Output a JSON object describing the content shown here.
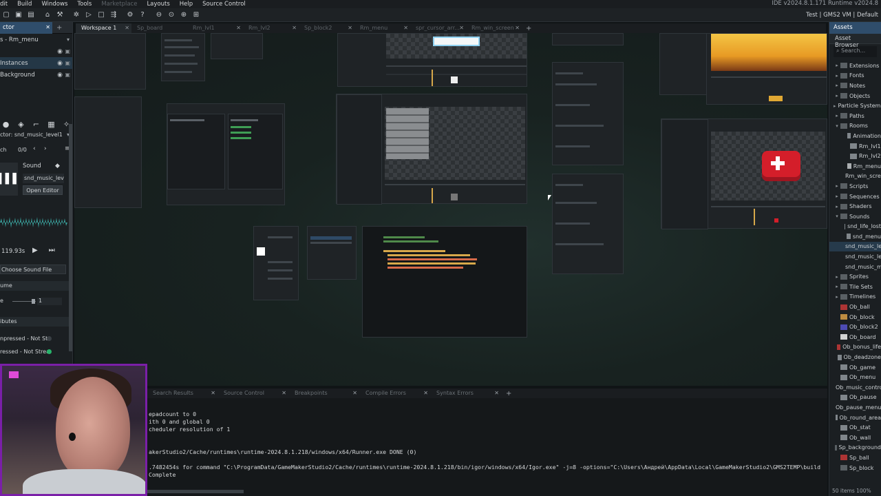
{
  "menubar": {
    "items": [
      "dit",
      "Build",
      "Windows",
      "Tools",
      "Marketplace",
      "Layouts",
      "Help",
      "Source Control"
    ],
    "ide_version": "IDE v2024.8.1.171  Runtime v2024.8"
  },
  "toolbar": {
    "target": "Test | GMS2 VM | Default"
  },
  "left": {
    "tab_label": "ctor",
    "room_name": "s - Rm_menu",
    "layers": [
      "Instances",
      "Background"
    ],
    "inspector_title": "ctor: snd_music_level1",
    "frame_counter": "0/0",
    "sound_type": "Sound",
    "sound_name": "snd_music_level1",
    "open_editor": "Open Editor",
    "duration": "119.93s",
    "choose_file": "Choose Sound File",
    "volume_header": "ume",
    "volume_label": "e",
    "volume_value": "1",
    "attributes_header": "ibutes",
    "compressed1": "npressed - Not Str",
    "compressed2": "ressed - Not Strea",
    "search_label": "ch"
  },
  "workspace_tabs": [
    {
      "label": "Workspace 1",
      "active": true
    },
    {
      "label": "Sp_board",
      "active": false
    },
    {
      "label": "Rm_lvl1",
      "active": false
    },
    {
      "label": "Rm_lvl2",
      "active": false
    },
    {
      "label": "Sp_block2",
      "active": false
    },
    {
      "label": "Rm_menu",
      "active": false
    },
    {
      "label": "spr_cursor_arr...",
      "active": false
    },
    {
      "label": "Rm_win_screen",
      "active": false
    }
  ],
  "assets": {
    "tab": "Assets",
    "title": "Asset Browser",
    "search_placeholder": "Search...",
    "items": [
      {
        "label": "Extensions",
        "indent": 1,
        "arrow": "▸",
        "color": "#6a7075"
      },
      {
        "label": "Fonts",
        "indent": 1,
        "arrow": "▸",
        "color": "#6a7075"
      },
      {
        "label": "Notes",
        "indent": 1,
        "arrow": "▸",
        "color": "#6a7075"
      },
      {
        "label": "Objects",
        "indent": 1,
        "arrow": "▸",
        "color": "#6a7075"
      },
      {
        "label": "Particle Systems",
        "indent": 1,
        "arrow": "▸",
        "color": "#6a7075"
      },
      {
        "label": "Paths",
        "indent": 1,
        "arrow": "▸",
        "color": "#6a7075"
      },
      {
        "label": "Rooms",
        "indent": 1,
        "arrow": "▾",
        "color": "#6a7075"
      },
      {
        "label": "Animation",
        "indent": 2,
        "arrow": "",
        "color": "#9aa0a6"
      },
      {
        "label": "Rm_lvl1",
        "indent": 2,
        "arrow": "",
        "color": "#9aa0a6"
      },
      {
        "label": "Rm_lvl2",
        "indent": 2,
        "arrow": "",
        "color": "#9aa0a6"
      },
      {
        "label": "Rm_menu",
        "indent": 2,
        "arrow": "",
        "color": "#cfd3d6"
      },
      {
        "label": "Rm_win_screen",
        "indent": 2,
        "arrow": "",
        "color": "#9aa0a6"
      },
      {
        "label": "Scripts",
        "indent": 1,
        "arrow": "▸",
        "color": "#6a7075"
      },
      {
        "label": "Sequences",
        "indent": 1,
        "arrow": "▸",
        "color": "#6a7075"
      },
      {
        "label": "Shaders",
        "indent": 1,
        "arrow": "▸",
        "color": "#6a7075"
      },
      {
        "label": "Sounds",
        "indent": 1,
        "arrow": "▾",
        "color": "#6a7075"
      },
      {
        "label": "snd_life_lost",
        "indent": 2,
        "arrow": "",
        "color": "#9aa0a6"
      },
      {
        "label": "snd_menu",
        "indent": 2,
        "arrow": "",
        "color": "#9aa0a6"
      },
      {
        "label": "snd_music_level1",
        "indent": 2,
        "arrow": "",
        "color": "#9aa0a6",
        "selected": true
      },
      {
        "label": "snd_music_level2",
        "indent": 2,
        "arrow": "",
        "color": "#9aa0a6"
      },
      {
        "label": "snd_music_menu",
        "indent": 2,
        "arrow": "",
        "color": "#9aa0a6"
      },
      {
        "label": "Sprites",
        "indent": 1,
        "arrow": "▸",
        "color": "#6a7075"
      },
      {
        "label": "Tile Sets",
        "indent": 1,
        "arrow": "▸",
        "color": "#6a7075"
      },
      {
        "label": "Timelines",
        "indent": 1,
        "arrow": "▸",
        "color": "#6a7075"
      },
      {
        "label": "Ob_ball",
        "indent": 1,
        "arrow": "",
        "color": "#d23a3a"
      },
      {
        "label": "Ob_block",
        "indent": 1,
        "arrow": "",
        "color": "#e7a84a"
      },
      {
        "label": "Ob_block2",
        "indent": 1,
        "arrow": "",
        "color": "#5a56d8"
      },
      {
        "label": "Ob_board",
        "indent": 1,
        "arrow": "",
        "color": "#ffffff"
      },
      {
        "label": "Ob_bonus_life",
        "indent": 1,
        "arrow": "",
        "color": "#d23a3a"
      },
      {
        "label": "Ob_deadzone",
        "indent": 1,
        "arrow": "",
        "color": "#9aa0a6"
      },
      {
        "label": "Ob_game",
        "indent": 1,
        "arrow": "",
        "color": "#9aa0a6"
      },
      {
        "label": "Ob_menu",
        "indent": 1,
        "arrow": "",
        "color": "#9aa0a6"
      },
      {
        "label": "Ob_music_controller",
        "indent": 1,
        "arrow": "",
        "color": "#9aa0a6"
      },
      {
        "label": "Ob_pause",
        "indent": 1,
        "arrow": "",
        "color": "#9aa0a6"
      },
      {
        "label": "Ob_pause_menu",
        "indent": 1,
        "arrow": "",
        "color": "#9aa0a6"
      },
      {
        "label": "Ob_round_area",
        "indent": 1,
        "arrow": "",
        "color": "#9aa0a6"
      },
      {
        "label": "Ob_stat",
        "indent": 1,
        "arrow": "",
        "color": "#9aa0a6"
      },
      {
        "label": "Ob_wall",
        "indent": 1,
        "arrow": "",
        "color": "#9aa0a6"
      },
      {
        "label": "Sp_background",
        "indent": 1,
        "arrow": "",
        "color": "#6a7075"
      },
      {
        "label": "Sp_ball",
        "indent": 1,
        "arrow": "",
        "color": "#d23a3a"
      },
      {
        "label": "Sp_block",
        "indent": 1,
        "arrow": "",
        "color": "#6a7075"
      }
    ],
    "footer": "50 items   100%"
  },
  "bottom": {
    "tabs": [
      "Search Results",
      "Source Control",
      "Breakpoints",
      "Compile Errors",
      "Syntax Errors"
    ],
    "lines": [
      "epadcount to 0",
      "ith 0 and global 0",
      "cheduler resolution of 1",
      "",
      "",
      "akerStudio2/Cache/runtimes\\runtime-2024.8.1.218/windows/x64/Runner.exe DONE (0)",
      "",
      ".7482454s for command \"C:\\ProgramData/GameMakerStudio2/Cache/runtimes\\runtime-2024.8.1.218/bin/igor/windows/x64/Igor.exe\" -j=8  -options=\"C:\\Users\\Андрей\\AppData\\Local\\GameMakerStudio2\\GMS2TEMP\\build",
      " Complete"
    ]
  }
}
